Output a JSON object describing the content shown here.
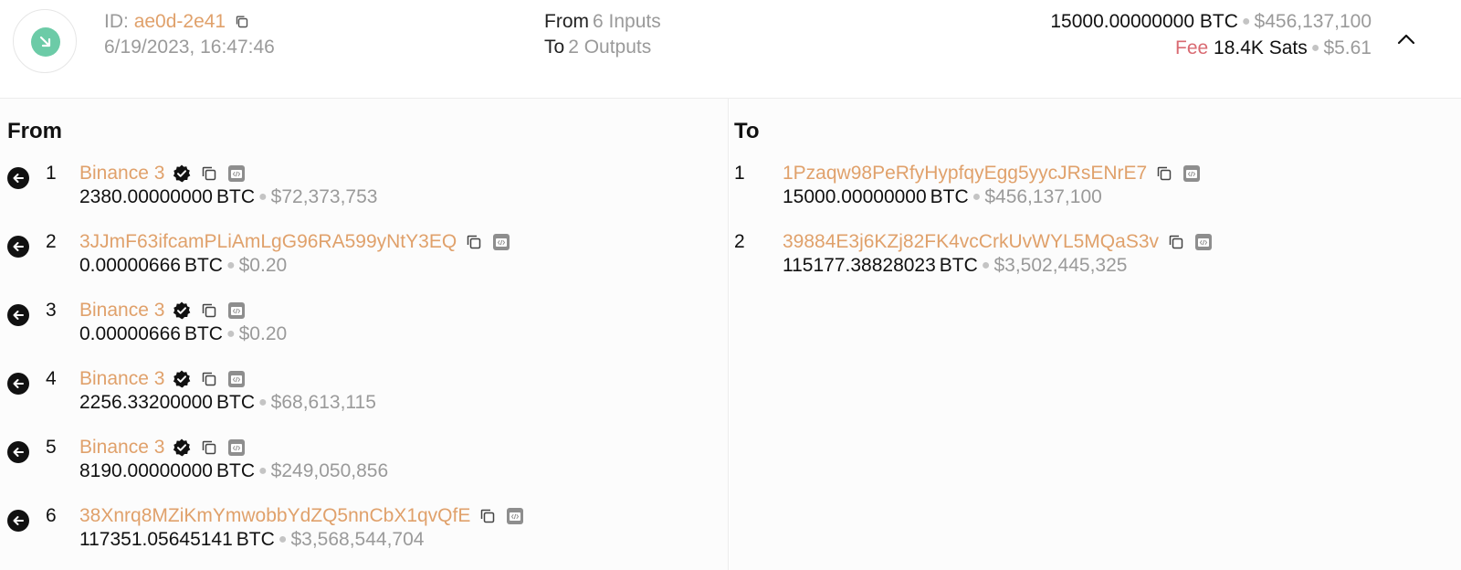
{
  "header": {
    "id_label": "ID:",
    "id_value": "ae0d-2e41",
    "timestamp": "6/19/2023, 16:47:46",
    "from_label": "From",
    "from_count": "6 Inputs",
    "to_label": "To",
    "to_count": "2 Outputs",
    "amount": "15000.00000000 BTC",
    "amount_usd": "$456,137,100",
    "fee_label": "Fee",
    "fee_value": "18.4K Sats",
    "fee_usd": "$5.61"
  },
  "from_panel": {
    "title": "From",
    "inputs": [
      {
        "index": "1",
        "address": "Binance 3",
        "verified": true,
        "amount": "2380.00000000",
        "unit": "BTC",
        "usd": "$72,373,753"
      },
      {
        "index": "2",
        "address": "3JJmF63ifcamPLiAmLgG96RA599yNtY3EQ",
        "verified": false,
        "amount": "0.00000666",
        "unit": "BTC",
        "usd": "$0.20"
      },
      {
        "index": "3",
        "address": "Binance 3",
        "verified": true,
        "amount": "0.00000666",
        "unit": "BTC",
        "usd": "$0.20"
      },
      {
        "index": "4",
        "address": "Binance 3",
        "verified": true,
        "amount": "2256.33200000",
        "unit": "BTC",
        "usd": "$68,613,115"
      },
      {
        "index": "5",
        "address": "Binance 3",
        "verified": true,
        "amount": "8190.00000000",
        "unit": "BTC",
        "usd": "$249,050,856"
      },
      {
        "index": "6",
        "address": "38Xnrq8MZiKmYmwobbYdZQ5nnCbX1qvQfE",
        "verified": false,
        "amount": "117351.05645141",
        "unit": "BTC",
        "usd": "$3,568,544,704"
      }
    ]
  },
  "to_panel": {
    "title": "To",
    "outputs": [
      {
        "index": "1",
        "address": "1Pzaqw98PeRfyHypfqyEgg5yycJRsENrE7",
        "amount": "15000.00000000",
        "unit": "BTC",
        "usd": "$456,137,100"
      },
      {
        "index": "2",
        "address": "39884E3j6KZj82FK4vcCrkUvWYL5MQaS3v",
        "amount": "115177.38828023",
        "unit": "BTC",
        "usd": "$3,502,445,325"
      }
    ]
  },
  "colors": {
    "accent_address": "#e0a16b",
    "status_green": "#6ccba7",
    "fee_red": "#d96a72",
    "muted": "#9a9a9a"
  },
  "icons": {
    "status": "arrow-down-right-icon",
    "copy": "copy-icon",
    "code": "code-icon",
    "verified": "verified-badge-icon",
    "input_arrow": "arrow-left-circle-icon",
    "collapse": "chevron-up-icon"
  }
}
